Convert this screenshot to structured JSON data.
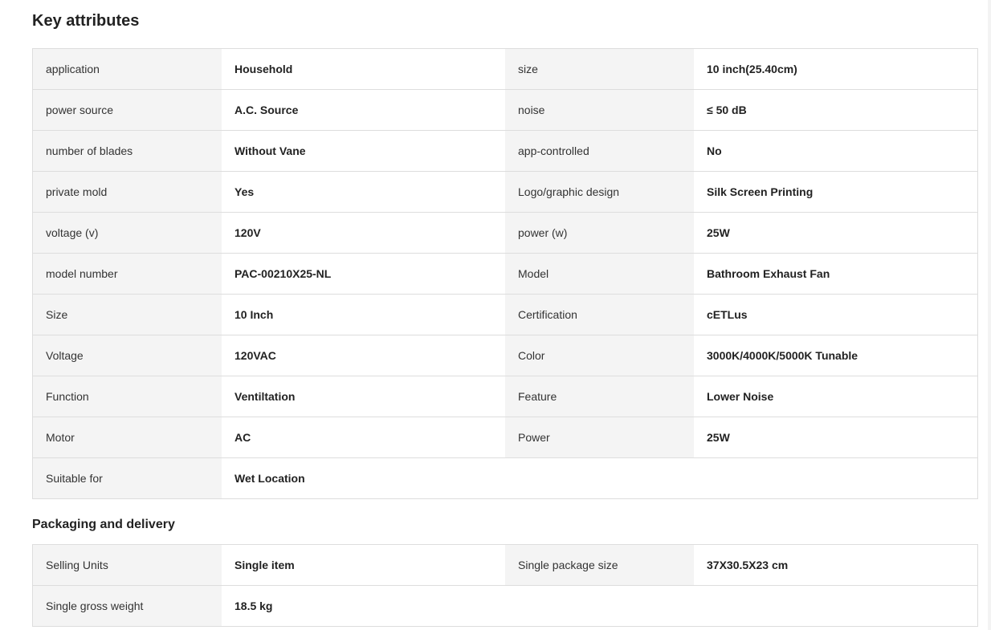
{
  "key_attributes": {
    "title": "Key attributes",
    "rows": [
      [
        {
          "label": "application",
          "value": "Household"
        },
        {
          "label": "size",
          "value": "10 inch(25.40cm)"
        }
      ],
      [
        {
          "label": "power source",
          "value": "A.C. Source"
        },
        {
          "label": "noise",
          "value": "≤ 50 dB"
        }
      ],
      [
        {
          "label": "number of blades",
          "value": "Without Vane"
        },
        {
          "label": "app-controlled",
          "value": "No"
        }
      ],
      [
        {
          "label": "private mold",
          "value": "Yes"
        },
        {
          "label": "Logo/graphic design",
          "value": "Silk Screen Printing"
        }
      ],
      [
        {
          "label": "voltage (v)",
          "value": "120V"
        },
        {
          "label": "power (w)",
          "value": "25W"
        }
      ],
      [
        {
          "label": "model number",
          "value": "PAC-00210X25-NL"
        },
        {
          "label": "Model",
          "value": "Bathroom Exhaust Fan"
        }
      ],
      [
        {
          "label": "Size",
          "value": "10 Inch"
        },
        {
          "label": "Certification",
          "value": "cETLus"
        }
      ],
      [
        {
          "label": "Voltage",
          "value": "120VAC"
        },
        {
          "label": "Color",
          "value": "3000K/4000K/5000K Tunable"
        }
      ],
      [
        {
          "label": "Function",
          "value": "Ventiltation"
        },
        {
          "label": "Feature",
          "value": "Lower Noise"
        }
      ],
      [
        {
          "label": "Motor",
          "value": "AC"
        },
        {
          "label": "Power",
          "value": "25W"
        }
      ],
      [
        {
          "label": "Suitable for",
          "value": "Wet Location"
        }
      ]
    ]
  },
  "packaging": {
    "title": "Packaging and delivery",
    "rows": [
      [
        {
          "label": "Selling Units",
          "value": "Single item"
        },
        {
          "label": "Single package size",
          "value": "37X30.5X23 cm"
        }
      ],
      [
        {
          "label": "Single gross weight",
          "value": "18.5 kg"
        }
      ]
    ]
  }
}
